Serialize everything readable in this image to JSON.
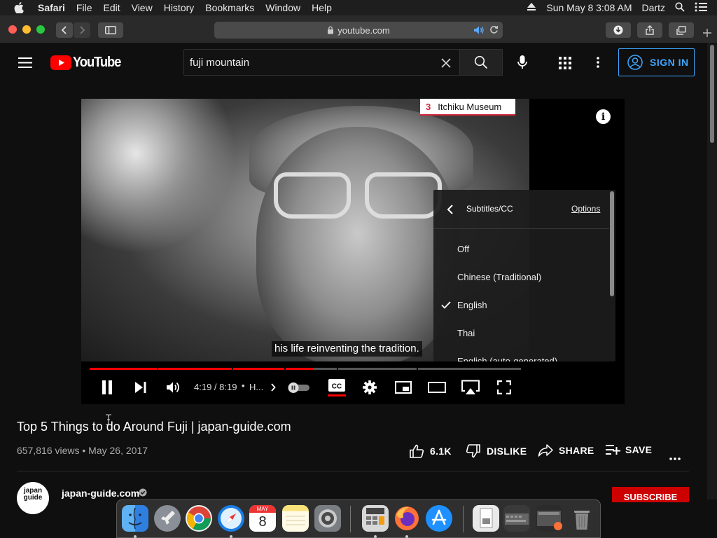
{
  "menubar": {
    "app": "Safari",
    "items": [
      "File",
      "Edit",
      "View",
      "History",
      "Bookmarks",
      "Window",
      "Help"
    ],
    "clock": "Sun May 8  3:08 AM",
    "user": "Dartz"
  },
  "browser": {
    "url": "youtube.com"
  },
  "youtube": {
    "logo_text": "YouTube",
    "search_query": "fuji mountain",
    "sign_in": "SIGN IN"
  },
  "video": {
    "tag_number": "3",
    "tag_label": "Itchiku Museum",
    "info_glyph": "i",
    "caption": "his life reinventing the tradition.",
    "time": "4:19 / 8:19",
    "chapter": "H...",
    "progress_fraction": 0.52
  },
  "cc_menu": {
    "title": "Subtitles/CC",
    "options_label": "Options",
    "items": [
      {
        "label": "Off",
        "selected": false
      },
      {
        "label": "Chinese (Traditional)",
        "selected": false
      },
      {
        "label": "English",
        "selected": true
      },
      {
        "label": "Thai",
        "selected": false
      },
      {
        "label": "English (auto-generated)",
        "selected": false
      }
    ]
  },
  "details": {
    "title": "Top 5 Things to do Around Fuji | japan-guide.com",
    "meta": "657,816 views • May 26, 2017",
    "likes": "6.1K",
    "dislike": "DISLIKE",
    "share": "SHARE",
    "save": "SAVE",
    "channel": "japan-guide.com",
    "channel_avatar": "japan guide",
    "subscribe": "SUBSCRIBE"
  },
  "dock": {
    "calendar_month": "MAY",
    "calendar_day": "8"
  },
  "colors": {
    "accent_red": "#ff0000",
    "link_blue": "#3ea6ff",
    "subscribe_red": "#cc0000"
  }
}
